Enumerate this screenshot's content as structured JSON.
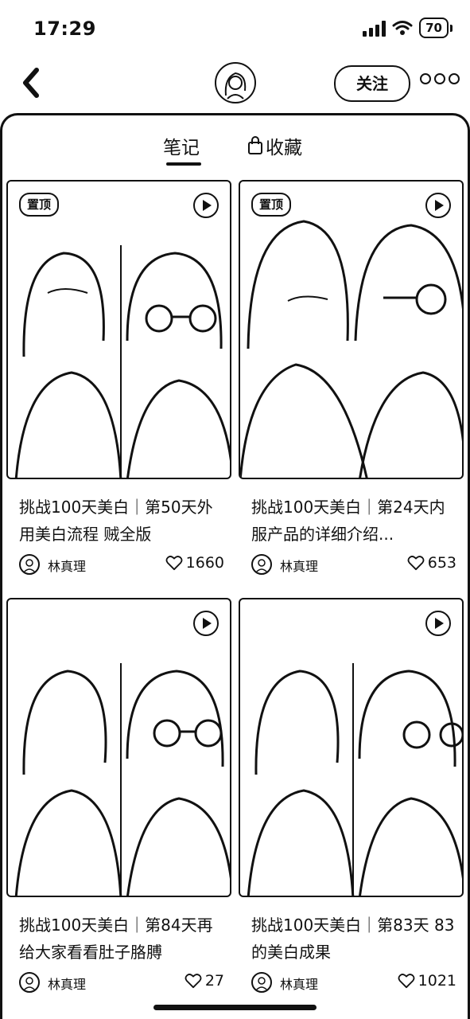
{
  "status_bar": {
    "time": "17:29",
    "battery": "70"
  },
  "nav": {
    "follow_label": "关注"
  },
  "tabs": {
    "notes": "笔记",
    "favorites": "收藏"
  },
  "cards": [
    {
      "pinned": "置顶",
      "title": "挑战100天美白｜第50天外用美白流程 贼全版",
      "author": "林真理",
      "likes": "1660"
    },
    {
      "pinned": "置顶",
      "title": "挑战100天美白｜第24天内服产品的详细介绍...",
      "author": "林真理",
      "likes": "653"
    },
    {
      "pinned": "",
      "title": "挑战100天美白｜第84天再给大家看看肚子胳膊",
      "author": "林真理",
      "likes": "27"
    },
    {
      "pinned": "",
      "title": "挑战100天美白｜第83天 83的美白成果",
      "author": "林真理",
      "likes": "1021"
    }
  ],
  "icons": {
    "back": "chevron-left-icon",
    "more": "more-dots-icon",
    "lock": "lock-icon",
    "play": "video-play-icon",
    "like": "heart-icon"
  }
}
